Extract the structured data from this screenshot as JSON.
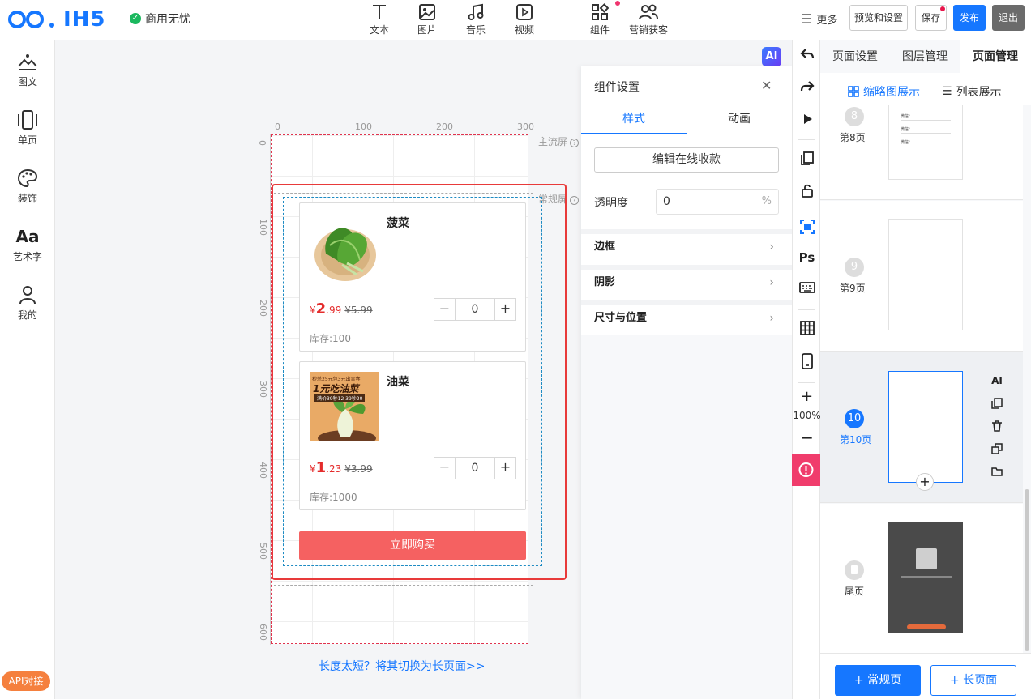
{
  "header": {
    "logo_text": "IH5",
    "commercial_text": "商用无忧",
    "tools": [
      {
        "label": "文本",
        "icon": "text-icon"
      },
      {
        "label": "图片",
        "icon": "image-icon"
      },
      {
        "label": "音乐",
        "icon": "music-icon"
      },
      {
        "label": "视频",
        "icon": "video-icon"
      },
      {
        "label": "组件",
        "icon": "components-icon"
      },
      {
        "label": "营销获客",
        "icon": "users-icon"
      }
    ],
    "more_label": "更多",
    "preview_label": "预览和设置",
    "save_label": "保存",
    "publish_label": "发布",
    "exit_label": "退出",
    "notice_color": "#f0346e"
  },
  "sidebar": {
    "items": [
      {
        "label": "图文",
        "icon": "image-text-icon"
      },
      {
        "label": "单页",
        "icon": "single-page-icon"
      },
      {
        "label": "装饰",
        "icon": "palette-icon"
      },
      {
        "label": "艺术字",
        "icon": "art-text-icon"
      },
      {
        "label": "我的",
        "icon": "user-icon"
      }
    ],
    "api_badge": "API对接"
  },
  "canvas": {
    "ai_badge": "AI",
    "ruler_top": [
      "0",
      "100",
      "200",
      "300"
    ],
    "ruler_left": [
      "0",
      "100",
      "200",
      "300",
      "400",
      "500",
      "600"
    ],
    "label_main_screen": "主流屏",
    "label_normal_screen": "常规屏",
    "products": [
      {
        "name": "菠菜",
        "currency": "¥",
        "price_int": "2",
        "price_dec": ".99",
        "original_price": "¥5.99",
        "quantity": "0",
        "stock": "库存:100",
        "image": "spinach-image"
      },
      {
        "name": "油菜",
        "currency": "¥",
        "price_int": "1",
        "price_dec": ".23",
        "original_price": "¥3.99",
        "quantity": "0",
        "stock": "库存:1000",
        "image": "bokchoy-image",
        "poster_lines": [
          "秒杀25元包3元出青春",
          "1元吃油菜",
          "满价39秒12 39秒20"
        ]
      }
    ],
    "buy_button": "立即购买",
    "switch_link": "长度太短？将其切换为长页面>>",
    "selection_color": "#e83a3a",
    "buy_color": "#f56161",
    "price_color": "#e42b2b"
  },
  "settings": {
    "title": "组件设置",
    "tabs": [
      "样式",
      "动画"
    ],
    "edit_payment_button": "编辑在线收款",
    "opacity_label": "透明度",
    "opacity_value": "0",
    "opacity_unit": "%",
    "sections": [
      "边框",
      "阴影",
      "尺寸与位置"
    ]
  },
  "toolstrip": {
    "zoom": "100%",
    "icons": [
      "undo-icon",
      "redo-icon",
      "play-icon",
      "copy-icon",
      "unlock-icon",
      "check-icon",
      "photoshop-icon",
      "keyboard-icon",
      "grid-icon",
      "phone-icon",
      "zoom-in-icon",
      "zoom-out-icon",
      "alert-icon"
    ],
    "ps_label": "Ps",
    "alert_color": "#f03c6c"
  },
  "page_manager": {
    "tabs": [
      "页面设置",
      "图层管理",
      "页面管理"
    ],
    "view_thumb": "缩略图展示",
    "view_list": "列表展示",
    "pages": [
      {
        "num": "8",
        "label": "第8页",
        "lines": [
          "微信：",
          "微信：",
          "微信："
        ]
      },
      {
        "num": "9",
        "label": "第9页"
      },
      {
        "num": "10",
        "label": "第10页"
      },
      {
        "num": "",
        "label": "尾页"
      }
    ],
    "page_actions": [
      "AI"
    ],
    "add_normal": "+ 常规页",
    "add_long": "+ 长页面",
    "accent": "#1677ff"
  }
}
